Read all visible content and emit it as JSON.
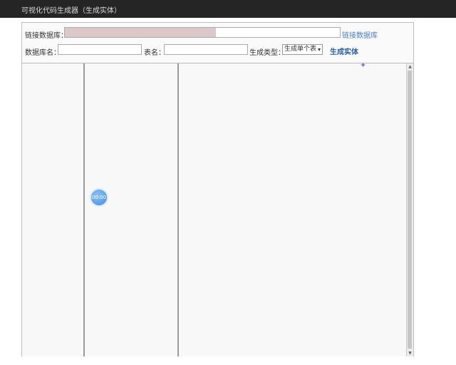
{
  "window": {
    "title": "可视化代码生成器（生成实体）"
  },
  "connection": {
    "label": "链接数据库：",
    "progress": 0.55,
    "link_label": "链接数据库"
  },
  "form": {
    "db_label": "数据库名：",
    "db_value": "",
    "table_label": "表名：",
    "table_value": "",
    "type_label": "生成类型：",
    "type_selected": "生成单个表",
    "generate_label": "生成实体"
  },
  "loading": {
    "text": "00:00"
  },
  "colors": {
    "titlebar": "#252525",
    "progress": "#dcc8c8",
    "link": "#4a7fc0",
    "spinner": "#3d8fe0"
  }
}
